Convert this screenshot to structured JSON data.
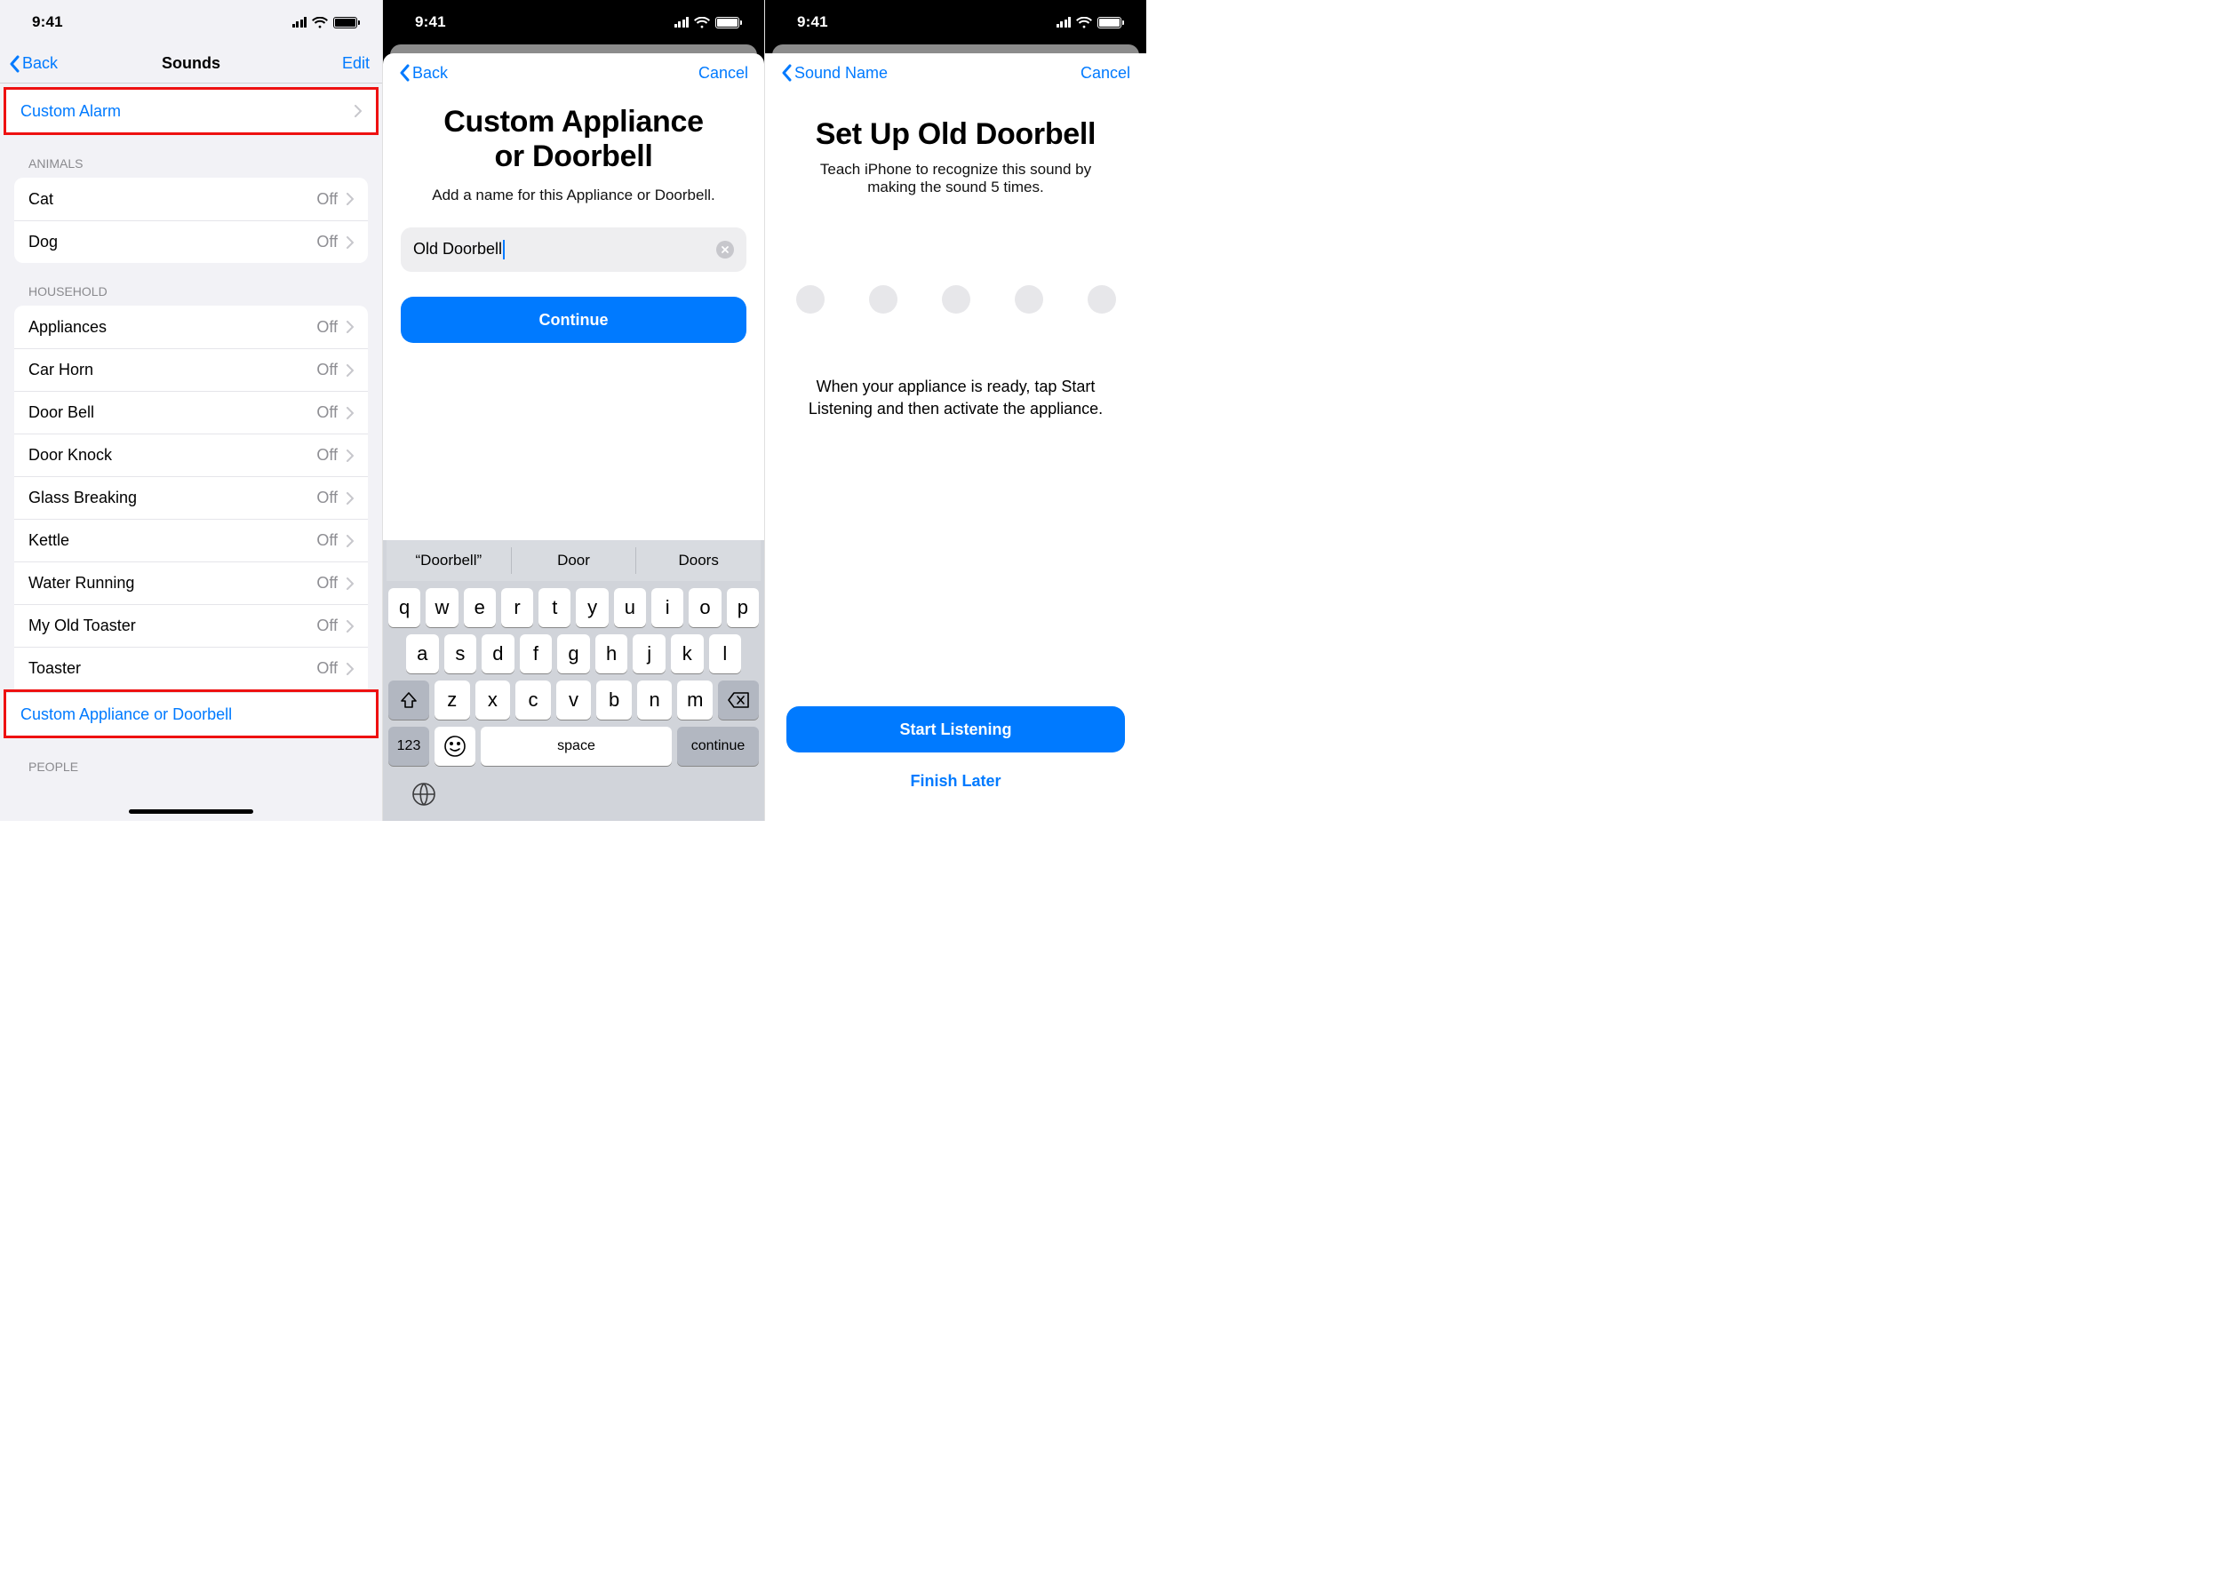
{
  "status": {
    "time": "9:41"
  },
  "screen1": {
    "nav": {
      "back": "Back",
      "title": "Sounds",
      "edit": "Edit"
    },
    "custom_alarm": "Custom Alarm",
    "sections": {
      "animals": {
        "header": "Animals",
        "items": [
          {
            "label": "Cat",
            "status": "Off"
          },
          {
            "label": "Dog",
            "status": "Off"
          }
        ]
      },
      "household": {
        "header": "Household",
        "items": [
          {
            "label": "Appliances",
            "status": "Off"
          },
          {
            "label": "Car Horn",
            "status": "Off"
          },
          {
            "label": "Door Bell",
            "status": "Off"
          },
          {
            "label": "Door Knock",
            "status": "Off"
          },
          {
            "label": "Glass Breaking",
            "status": "Off"
          },
          {
            "label": "Kettle",
            "status": "Off"
          },
          {
            "label": "Water Running",
            "status": "Off"
          },
          {
            "label": "My Old Toaster",
            "status": "Off"
          },
          {
            "label": "Toaster",
            "status": "Off"
          }
        ],
        "custom_row": "Custom Appliance or Doorbell"
      },
      "people": {
        "header": "People"
      }
    }
  },
  "screen2": {
    "nav": {
      "back": "Back",
      "cancel": "Cancel"
    },
    "title_line1": "Custom Appliance",
    "title_line2": "or Doorbell",
    "subtitle": "Add a name for this Appliance or Doorbell.",
    "input_value": "Old Doorbell",
    "continue": "Continue",
    "suggestions": [
      "“Doorbell”",
      "Door",
      "Doors"
    ],
    "keys": {
      "row1": [
        "q",
        "w",
        "e",
        "r",
        "t",
        "y",
        "u",
        "i",
        "o",
        "p"
      ],
      "row2": [
        "a",
        "s",
        "d",
        "f",
        "g",
        "h",
        "j",
        "k",
        "l"
      ],
      "row3": [
        "z",
        "x",
        "c",
        "v",
        "b",
        "n",
        "m"
      ],
      "num": "123",
      "space": "space",
      "cont": "continue"
    }
  },
  "screen3": {
    "nav": {
      "back": "Sound Name",
      "cancel": "Cancel"
    },
    "title": "Set Up Old Doorbell",
    "subtitle": "Teach iPhone to recognize this sound by making the sound 5 times.",
    "instruction": "When your appliance is ready, tap Start Listening and then activate the appliance.",
    "start": "Start Listening",
    "finish": "Finish Later"
  }
}
